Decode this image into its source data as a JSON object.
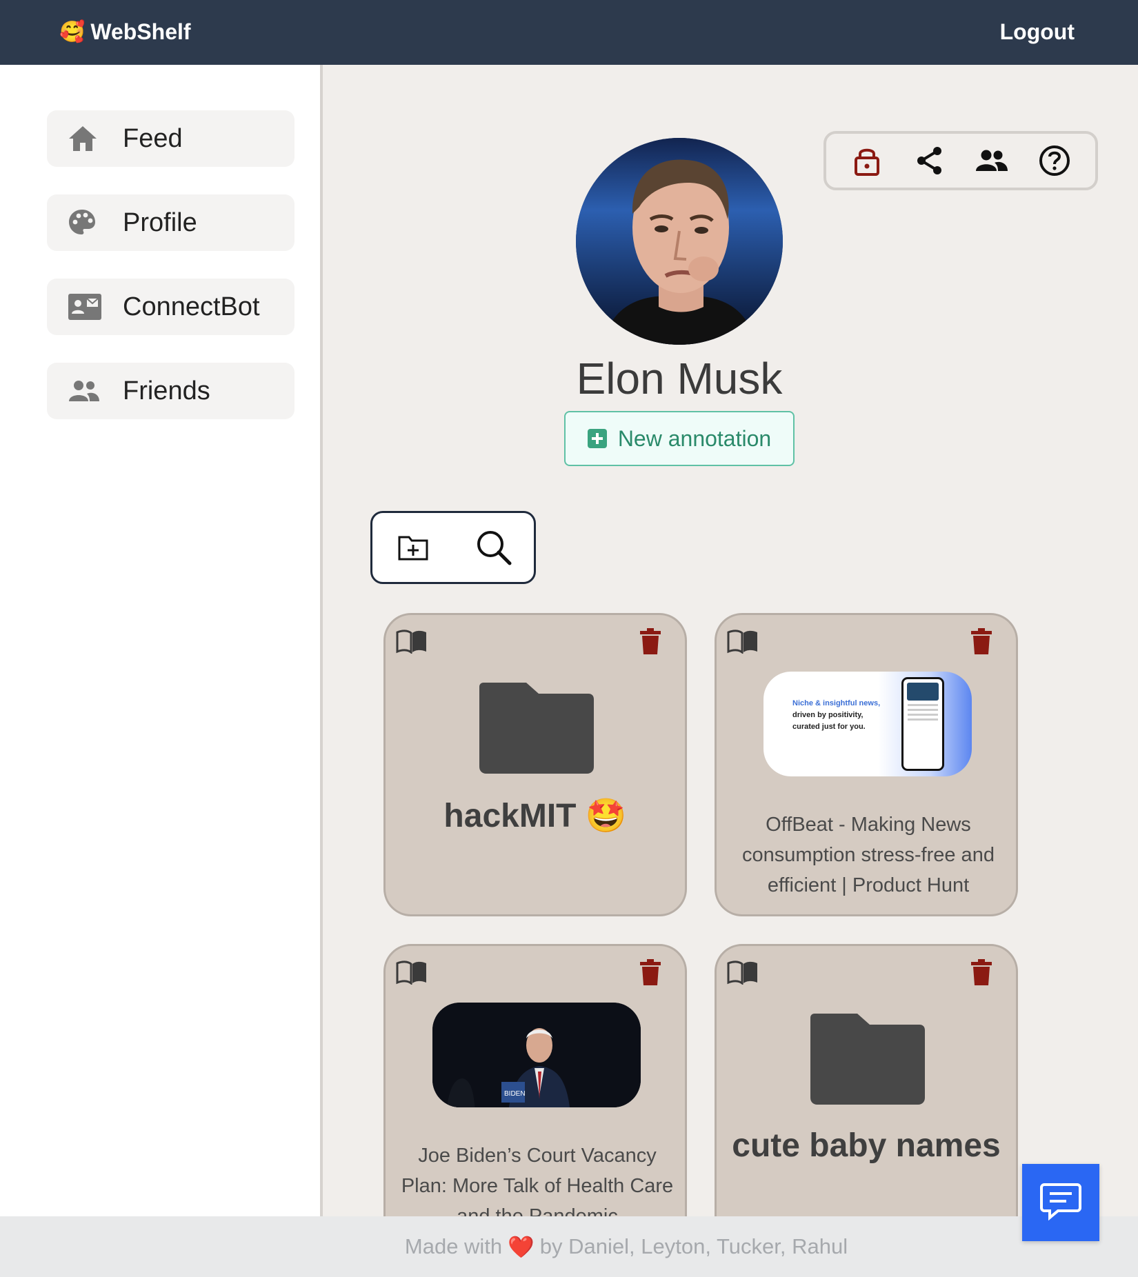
{
  "nav": {
    "brand": "WebShelf",
    "brand_emoji": "🥰",
    "logout": "Logout"
  },
  "sidebar": {
    "items": [
      {
        "label": "Feed",
        "icon": "home-icon"
      },
      {
        "label": "Profile",
        "icon": "palette-icon"
      },
      {
        "label": "ConnectBot",
        "icon": "contact-card-icon"
      },
      {
        "label": "Friends",
        "icon": "people-icon"
      }
    ]
  },
  "profile": {
    "name": "Elon Musk",
    "new_annotation": "New annotation"
  },
  "toolbar": {
    "icons": [
      "lock-icon",
      "share-icon",
      "people-icon",
      "help-icon"
    ],
    "lock_color": "#8b1a12"
  },
  "folder_tools": {
    "icons": [
      "new-folder-icon",
      "search-icon"
    ]
  },
  "cards": [
    {
      "type": "folder",
      "title": "hackMIT 🤩"
    },
    {
      "type": "link",
      "title": "OffBeat - Making News consumption stress-free and efficient | Product Hunt",
      "thumb_lines": [
        "Niche & insightful news,",
        "driven by positivity,",
        "curated just for you."
      ]
    },
    {
      "type": "link",
      "title": "Joe Biden’s Court Vacancy Plan: More Talk of Health Care and the Pandemic"
    },
    {
      "type": "folder",
      "title": "cute baby names"
    }
  ],
  "footer": {
    "prefix": "Made with",
    "heart": "❤️",
    "suffix": "by Daniel, Leyton, Tucker, Rahul"
  },
  "colors": {
    "topbar": "#2d3a4d",
    "trash": "#8b1a12",
    "chat": "#2a67f3",
    "accent_green": "#3aa37f"
  }
}
